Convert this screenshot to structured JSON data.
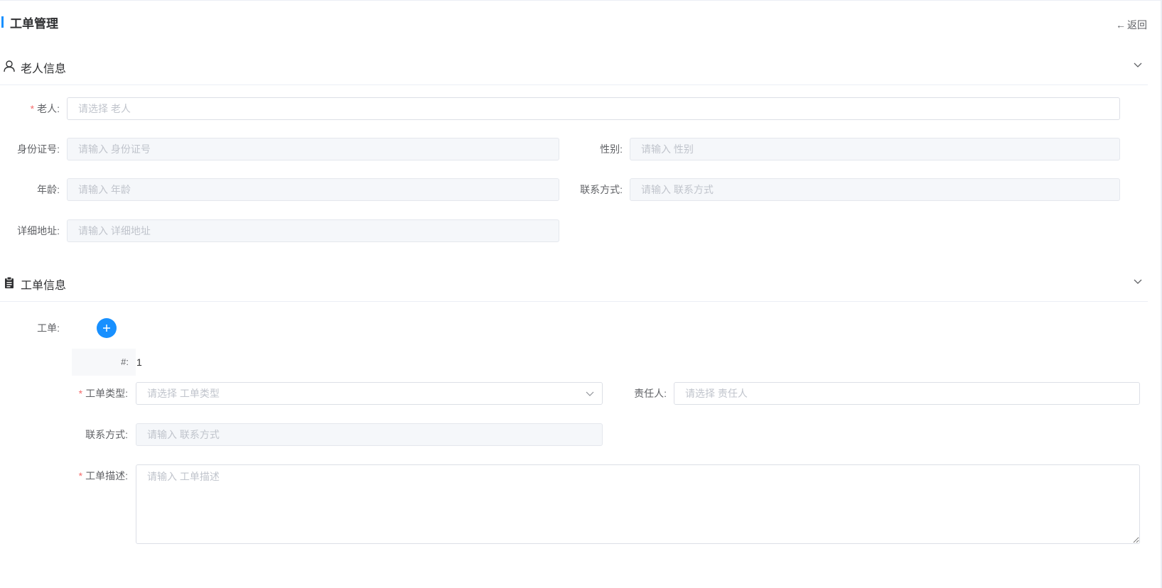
{
  "header": {
    "title": "工单管理",
    "back_label": "返回"
  },
  "elder_section": {
    "title": "老人信息",
    "fields": {
      "elder": {
        "label": "老人:",
        "placeholder": "请选择 老人",
        "required": true
      },
      "id_number": {
        "label": "身份证号:",
        "placeholder": "请输入 身份证号"
      },
      "gender": {
        "label": "性别:",
        "placeholder": "请输入 性别"
      },
      "age": {
        "label": "年龄:",
        "placeholder": "请输入 年龄"
      },
      "contact": {
        "label": "联系方式:",
        "placeholder": "请输入 联系方式"
      },
      "address": {
        "label": "详细地址:",
        "placeholder": "请输入 详细地址"
      }
    }
  },
  "order_section": {
    "title": "工单信息",
    "orders_label": "工单:",
    "index_label": "#:",
    "index_value": "1",
    "fields": {
      "order_type": {
        "label": "工单类型:",
        "placeholder": "请选择 工单类型",
        "required": true
      },
      "assignee": {
        "label": "责任人:",
        "placeholder": "请选择 责任人"
      },
      "contact": {
        "label": "联系方式:",
        "placeholder": "请输入 联系方式"
      },
      "description": {
        "label": "工单描述:",
        "placeholder": "请输入 工单描述",
        "required": true
      }
    }
  },
  "colors": {
    "primary": "#1890ff",
    "required": "#f56c6c",
    "disabled_bg": "#f5f7fa"
  },
  "icons": {
    "elder": "user-icon",
    "order": "clipboard-icon",
    "collapse": "chevron-down-icon",
    "add": "plus-icon",
    "back": "arrow-left-icon"
  }
}
